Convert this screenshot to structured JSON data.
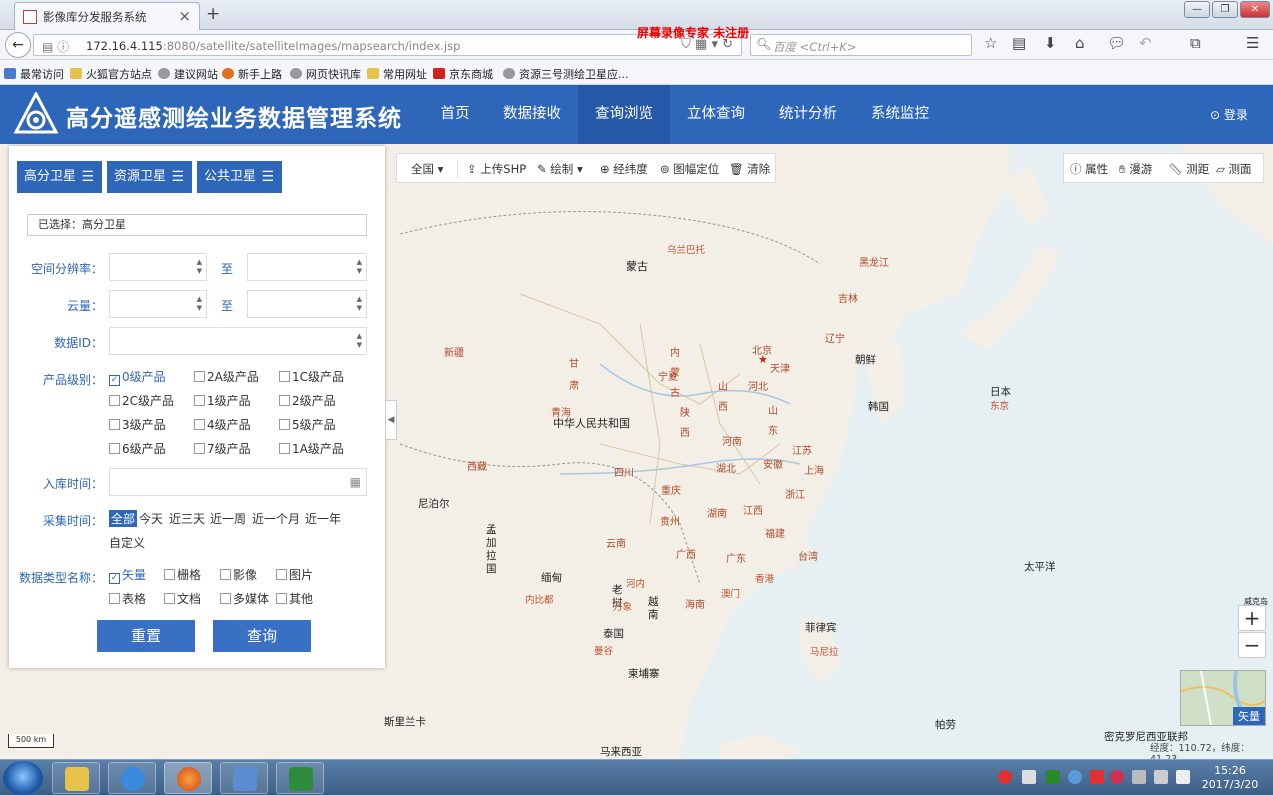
{
  "browser": {
    "tab_title": "影像库分发服务系统",
    "url_host": "172.16.4.115",
    "url_rest": ":8080/satellite/satelliteImages/mapsearch/index.jsp",
    "search_placeholder": "百度 <Ctrl+K>",
    "watermark": "屏幕录像专家  未注册",
    "bookmarks": [
      "最常访问",
      "火狐官方站点",
      "建议网站",
      "新手上路",
      "网页快讯库",
      "常用网址",
      "京东商城",
      "资源三号测绘卫星应..."
    ]
  },
  "app": {
    "title": "高分遥感测绘业务数据管理系统",
    "nav": [
      "首页",
      "数据接收",
      "查询浏览",
      "立体查询",
      "统计分析",
      "系统监控"
    ],
    "active_nav": "查询浏览",
    "login": "登录"
  },
  "panel": {
    "sat_tabs": [
      "高分卫星",
      "资源卫星",
      "公共卫星"
    ],
    "selected": "已选择：高分卫星",
    "labels": {
      "resolution": "空间分辨率：",
      "cloud": "云量：",
      "data_id": "数据ID：",
      "level": "产品级别：",
      "storage_time": "入库时间：",
      "collect_time": "采集时间：",
      "data_type": "数据类型名称："
    },
    "to": "至",
    "levels": [
      {
        "label": "0级产品",
        "checked": true
      },
      {
        "label": "2A级产品",
        "checked": false
      },
      {
        "label": "1C级产品",
        "checked": false
      },
      {
        "label": "2C级产品",
        "checked": false
      },
      {
        "label": "1级产品",
        "checked": false
      },
      {
        "label": "2级产品",
        "checked": false
      },
      {
        "label": "3级产品",
        "checked": false
      },
      {
        "label": "4级产品",
        "checked": false
      },
      {
        "label": "5级产品",
        "checked": false
      },
      {
        "label": "6级产品",
        "checked": false
      },
      {
        "label": "7级产品",
        "checked": false
      },
      {
        "label": "1A级产品",
        "checked": false
      }
    ],
    "collect_options": [
      "全部",
      "今天",
      "近三天",
      "近一周",
      "近一个月",
      "近一年",
      "自定义"
    ],
    "collect_selected": "全部",
    "data_types": [
      {
        "label": "矢量",
        "checked": true
      },
      {
        "label": "栅格",
        "checked": false
      },
      {
        "label": "影像",
        "checked": false
      },
      {
        "label": "图片",
        "checked": false
      },
      {
        "label": "表格",
        "checked": false
      },
      {
        "label": "文档",
        "checked": false
      },
      {
        "label": "多媒体",
        "checked": false
      },
      {
        "label": "其他",
        "checked": false
      }
    ],
    "reset": "重置",
    "query": "查询"
  },
  "map_toolbar": {
    "region": "全国",
    "upload": "上传SHP",
    "draw": "绘制",
    "lonlat": "经纬度",
    "sheet": "图幅定位",
    "clear": "清除"
  },
  "map_rtoolbar": {
    "attr": "属性",
    "pan": "漫游",
    "dist": "测距",
    "area": "测面"
  },
  "map": {
    "labels": [
      "蒙古",
      "中华人民共和国",
      "朝鲜",
      "韩国",
      "日本",
      "太平洋",
      "尼泊尔",
      "孟加拉国",
      "缅甸",
      "老挝",
      "泰国",
      "柬埔寨",
      "越南",
      "菲律宾",
      "马来西亚",
      "斯里兰卡",
      "帕劳",
      "密克罗尼西亚联邦",
      "新疆",
      "西藏",
      "青海",
      "甘肃",
      "内蒙古",
      "黑龙江",
      "吉林",
      "辽宁",
      "北京",
      "河北",
      "山西",
      "山东",
      "河南",
      "陕西",
      "四川",
      "重庆",
      "湖北",
      "安徽",
      "江苏",
      "上海",
      "浙江",
      "江西",
      "湖南",
      "贵州",
      "云南",
      "广西",
      "广东",
      "福建",
      "台湾",
      "海南",
      "宁夏",
      "天津",
      "乌兰巴托",
      "东京",
      "香港",
      "澳门",
      "河内",
      "万象",
      "内比都",
      "曼谷",
      "马尼拉",
      "威克岛"
    ],
    "scale": "500 km",
    "coord": "经度：110.72，纬度：41.23",
    "basemap": "矢量"
  },
  "taskbar": {
    "time": "15:26",
    "date": "2017/3/20"
  }
}
